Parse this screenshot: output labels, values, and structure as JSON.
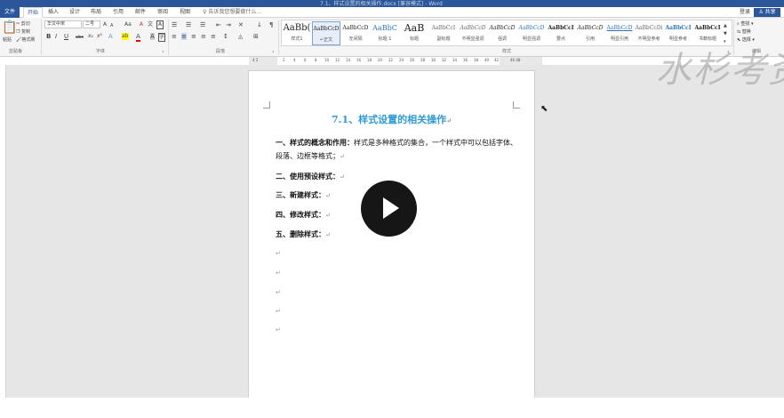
{
  "titlebar": {
    "title": "7.1、样式设置的相关操作.docx [兼容模式] - Word"
  },
  "tabs": [
    {
      "label": "文件"
    },
    {
      "label": "开始"
    },
    {
      "label": "插入"
    },
    {
      "label": "设计"
    },
    {
      "label": "布局"
    },
    {
      "label": "引用"
    },
    {
      "label": "邮件"
    },
    {
      "label": "审阅"
    },
    {
      "label": "视图"
    }
  ],
  "tellme": {
    "placeholder": "告诉我您想要做什么..."
  },
  "account": {
    "login": "登录",
    "share": "共享"
  },
  "clipboard": {
    "paste": "粘贴",
    "cut": "剪切",
    "copy": "复制",
    "format_painter": "格式刷",
    "label": "剪贴板"
  },
  "font": {
    "name": "华文中宋",
    "size": "二号",
    "label": "字体",
    "grow": "A",
    "shrink": "A",
    "case": "Aa",
    "clear": "A",
    "phonetic": "文",
    "border": "A",
    "bold": "B",
    "italic": "I",
    "underline": "U",
    "strike": "abc",
    "sub": "x₂",
    "sup": "x²",
    "effects": "A",
    "highlight": "ab",
    "color": "A",
    "shade": "A",
    "char_border": "字"
  },
  "paragraph": {
    "label": "段落",
    "sort": "↓",
    "show_marks": "¶"
  },
  "styles": {
    "label": "样式",
    "items": [
      {
        "preview": "AaBb(",
        "name": "样式1",
        "size": "10px"
      },
      {
        "preview": "AaBbCcD",
        "name": "↵正文",
        "size": "6px"
      },
      {
        "preview": "AaBbCcD",
        "name": "无间隔",
        "size": "6px"
      },
      {
        "preview": "AaBbC",
        "name": "标题 1",
        "size": "8px"
      },
      {
        "preview": "AaB",
        "name": "标题",
        "size": "11px"
      },
      {
        "preview": "AaBbCcI",
        "name": "副标题",
        "size": "6px"
      },
      {
        "preview": "AaBbCcD",
        "name": "不明显强调",
        "size": "6px"
      },
      {
        "preview": "AaBbCcD",
        "name": "强调",
        "size": "6px"
      },
      {
        "preview": "AaBbCcD",
        "name": "明显强调",
        "size": "6px"
      },
      {
        "preview": "AaBbCcI",
        "name": "要点",
        "size": "6px"
      },
      {
        "preview": "AaBbCcD",
        "name": "引用",
        "size": "6px"
      },
      {
        "preview": "AaBbCcD",
        "name": "明显引用",
        "size": "6px"
      },
      {
        "preview": "AaBbCcDi",
        "name": "不明显参考",
        "size": "6px"
      },
      {
        "preview": "AaBbCcI",
        "name": "明显参考",
        "size": "6px"
      },
      {
        "preview": "AaBbCcI",
        "name": "书籍标题",
        "size": "6px"
      }
    ]
  },
  "editing": {
    "find": "查找",
    "replace": "替换",
    "select": "选择",
    "label": "编辑"
  },
  "ruler": {
    "ticks": [
      "2",
      "4",
      "6",
      "8",
      "10",
      "12",
      "14",
      "16",
      "18",
      "20",
      "22",
      "24",
      "26",
      "28",
      "30",
      "32",
      "34",
      "36",
      "38",
      "40",
      "42"
    ],
    "left": "4 2",
    "right": "46 48"
  },
  "document": {
    "heading": "7.1、样式设置的相关操作",
    "para1_bold": "一、样式的概念和作用：",
    "para1_text": "样式是多种格式的集合，一个样式中可以包括字体、段落、边框等格式；",
    "items": [
      "二、使用预设样式：",
      "三、新建样式：",
      "四、修改样式：",
      "五、删除样式："
    ],
    "para_mark": "↵"
  },
  "watermark": {
    "text": "水杉考资"
  }
}
